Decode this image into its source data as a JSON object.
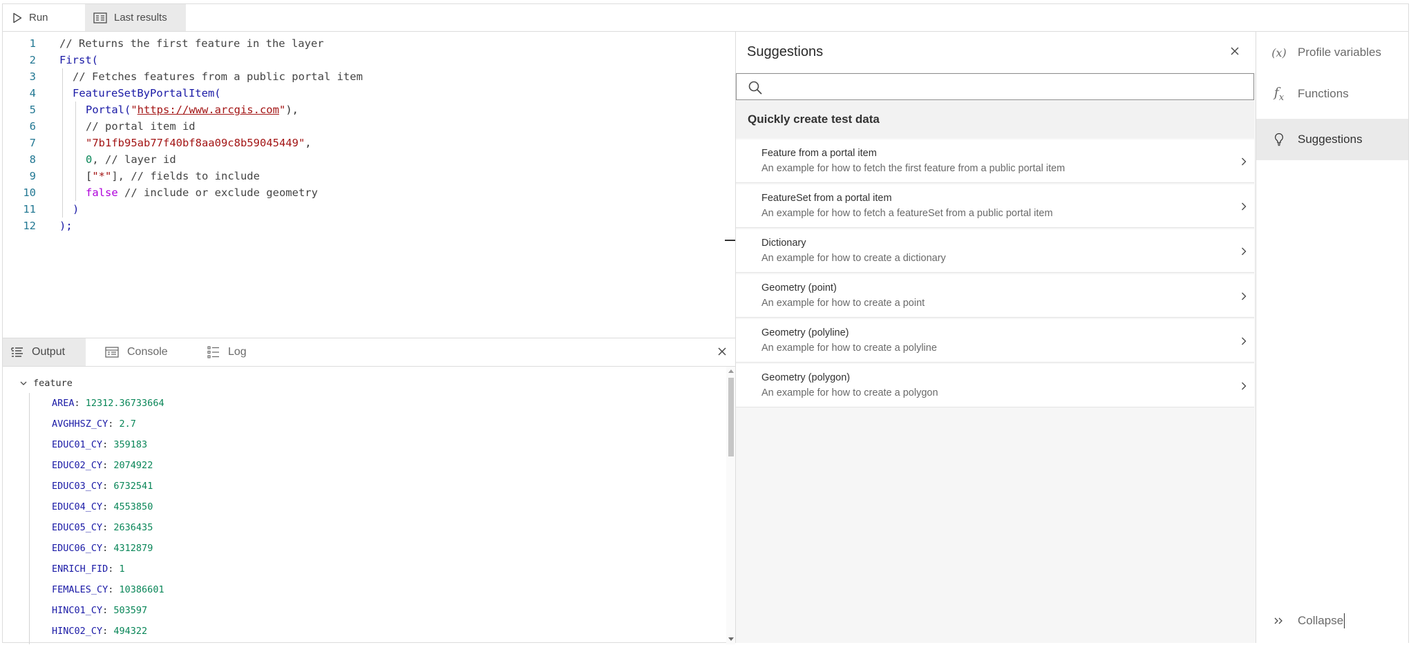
{
  "actionbar": {
    "run_label": "Run",
    "last_results_label": "Last results"
  },
  "editor": {
    "lines": [
      {
        "num": "1",
        "indent": 0,
        "tokens": [
          {
            "t": "// Returns the first feature in the layer",
            "c": "tk-c"
          }
        ]
      },
      {
        "num": "2",
        "indent": 0,
        "tokens": [
          {
            "t": "First(",
            "c": "tk-f"
          }
        ]
      },
      {
        "num": "3",
        "indent": 1,
        "tokens": [
          {
            "t": "// Fetches features from a public portal item",
            "c": "tk-c"
          }
        ]
      },
      {
        "num": "4",
        "indent": 1,
        "tokens": [
          {
            "t": "FeatureSetByPortalItem(",
            "c": "tk-f"
          }
        ]
      },
      {
        "num": "5",
        "indent": 2,
        "tokens": [
          {
            "t": "Portal(",
            "c": "tk-f"
          },
          {
            "t": "\"",
            "c": "tk-s"
          },
          {
            "t": "https://www.arcgis.com",
            "c": "tk-s tk-u"
          },
          {
            "t": "\"",
            "c": "tk-s"
          },
          {
            "t": "),",
            "c": "tk-p"
          }
        ]
      },
      {
        "num": "6",
        "indent": 2,
        "tokens": [
          {
            "t": "// portal item id",
            "c": "tk-c"
          }
        ]
      },
      {
        "num": "7",
        "indent": 2,
        "tokens": [
          {
            "t": "\"7b1fb95ab77f40bf8aa09c8b59045449\"",
            "c": "tk-s"
          },
          {
            "t": ",",
            "c": "tk-p"
          }
        ]
      },
      {
        "num": "8",
        "indent": 2,
        "tokens": [
          {
            "t": "0",
            "c": "tk-n"
          },
          {
            "t": ", // layer id",
            "c": "tk-c"
          }
        ]
      },
      {
        "num": "9",
        "indent": 2,
        "tokens": [
          {
            "t": "[",
            "c": "tk-p"
          },
          {
            "t": "\"*\"",
            "c": "tk-s"
          },
          {
            "t": "], // fields to include",
            "c": "tk-c"
          }
        ]
      },
      {
        "num": "10",
        "indent": 2,
        "tokens": [
          {
            "t": "false",
            "c": "tk-k"
          },
          {
            "t": " // include or exclude geometry",
            "c": "tk-c"
          }
        ]
      },
      {
        "num": "11",
        "indent": 1,
        "tokens": [
          {
            "t": ")",
            "c": "tk-f"
          }
        ]
      },
      {
        "num": "12",
        "indent": 0,
        "tokens": [
          {
            "t": ");",
            "c": "tk-f"
          }
        ]
      }
    ]
  },
  "output": {
    "tabs": {
      "output": "Output",
      "console": "Console",
      "log": "Log"
    },
    "feature_label": "feature",
    "rows": [
      {
        "key": "AREA",
        "value": "12312.36733664"
      },
      {
        "key": "AVGHHSZ_CY",
        "value": "2.7"
      },
      {
        "key": "EDUC01_CY",
        "value": "359183"
      },
      {
        "key": "EDUC02_CY",
        "value": "2074922"
      },
      {
        "key": "EDUC03_CY",
        "value": "6732541"
      },
      {
        "key": "EDUC04_CY",
        "value": "4553850"
      },
      {
        "key": "EDUC05_CY",
        "value": "2636435"
      },
      {
        "key": "EDUC06_CY",
        "value": "4312879"
      },
      {
        "key": "ENRICH_FID",
        "value": "1"
      },
      {
        "key": "FEMALES_CY",
        "value": "10386601"
      },
      {
        "key": "HINC01_CY",
        "value": "503597"
      },
      {
        "key": "HINC02_CY",
        "value": "494322"
      }
    ]
  },
  "suggestions": {
    "title": "Suggestions",
    "search_placeholder": "",
    "group_title": "Quickly create test data",
    "items": [
      {
        "title": "Feature from a portal item",
        "desc": "An example for how to fetch the first feature from a public portal item"
      },
      {
        "title": "FeatureSet from a portal item",
        "desc": "An example for how to fetch a featureSet from a public portal item"
      },
      {
        "title": "Dictionary",
        "desc": "An example for how to create a dictionary"
      },
      {
        "title": "Geometry (point)",
        "desc": "An example for how to create a point"
      },
      {
        "title": "Geometry (polyline)",
        "desc": "An example for how to create a polyline"
      },
      {
        "title": "Geometry (polygon)",
        "desc": "An example for how to create a polygon"
      }
    ]
  },
  "sidebar": {
    "items": [
      {
        "label": "Profile variables",
        "icon": "variable-icon",
        "active": false
      },
      {
        "label": "Functions",
        "icon": "function-icon",
        "active": false
      },
      {
        "label": "Suggestions",
        "icon": "lightbulb-icon",
        "active": true
      }
    ],
    "collapse_label": "Collapse"
  },
  "colors": {
    "accent_gray": "#eaeaea",
    "comment": "#444444",
    "function": "#1a1aa6",
    "string": "#a31515",
    "number": "#098658",
    "keyword": "#af00db"
  }
}
